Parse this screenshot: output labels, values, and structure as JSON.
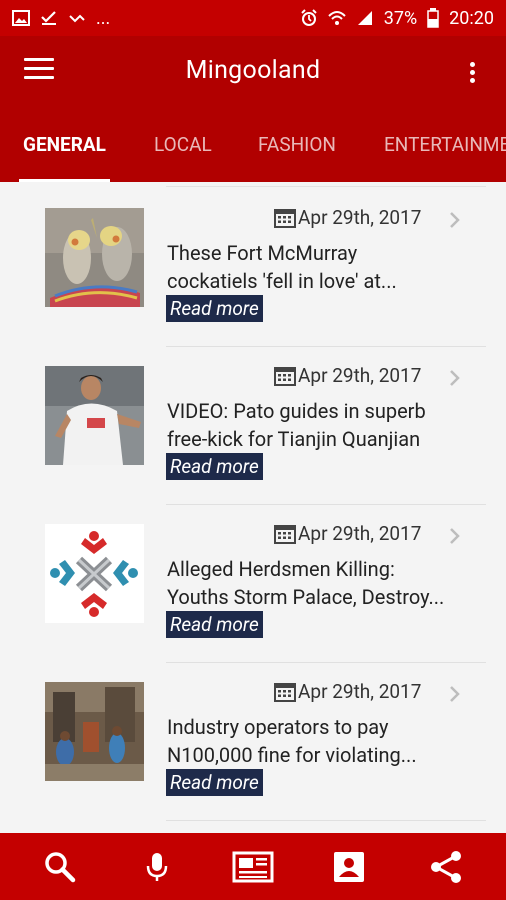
{
  "status_bar": {
    "battery": "37%",
    "time": "20:20",
    "overflow_dots": "..."
  },
  "app_bar": {
    "title": "Mingooland"
  },
  "tabs": [
    {
      "label": "GENERAL",
      "active": true
    },
    {
      "label": "LOCAL",
      "active": false
    },
    {
      "label": "FASHION",
      "active": false
    },
    {
      "label": "ENTERTAINMENT",
      "active": false
    }
  ],
  "news": [
    {
      "date": "Apr 29th, 2017",
      "title_lines": [
        "These Fort McMurray",
        "cockatiels 'fell in love' at..."
      ],
      "read_more": "Read more",
      "thumb": "cockatiels-photo"
    },
    {
      "date": "Apr 29th, 2017",
      "title_lines": [
        "VIDEO: Pato guides in superb",
        "free-kick for Tianjin Quanjian"
      ],
      "read_more": "Read more",
      "thumb": "soccer-player-photo"
    },
    {
      "date": "Apr 29th, 2017",
      "title_lines": [
        "Alleged Herdsmen Killing:",
        "Youths Storm Palace, Destroy..."
      ],
      "read_more": "Read more",
      "thumb": "red-blue-logo"
    },
    {
      "date": "Apr 29th, 2017",
      "title_lines": [
        "Industry operators to pay",
        "N100,000 fine for violating..."
      ],
      "read_more": "Read more",
      "thumb": "street-market-photo"
    }
  ],
  "bottom_nav": [
    "search-icon",
    "microphone-icon",
    "newspaper-icon",
    "contact-card-icon",
    "share-icon"
  ],
  "colors": {
    "primary": "#b10000",
    "status_bar": "#c40000",
    "read_more_bg": "#1e2a4a"
  }
}
